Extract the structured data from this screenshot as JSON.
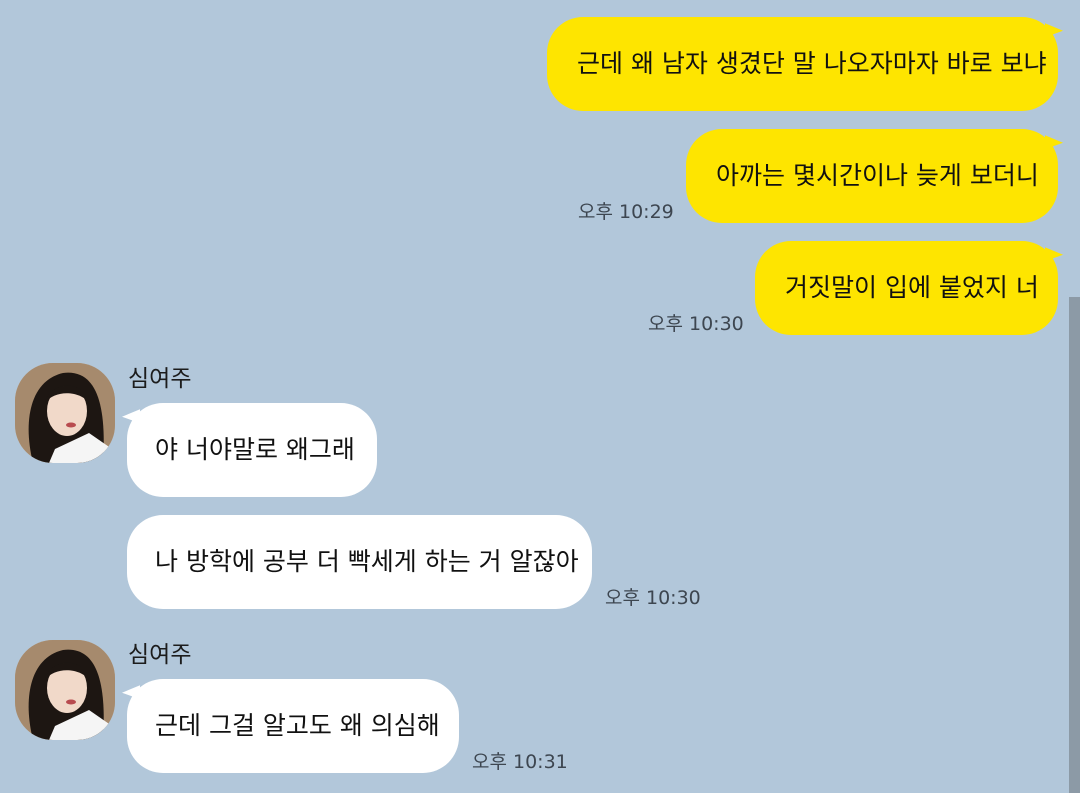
{
  "messages": {
    "m1": {
      "text": "근데 왜 남자 생겼단 말 나오자마자 바로 보냐"
    },
    "m2": {
      "text": "아까는 몇시간이나 늦게 보더니",
      "time": "오후 10:29"
    },
    "m3": {
      "text": "거짓말이 입에 붙었지 너",
      "time": "오후 10:30"
    },
    "m4": {
      "sender": "심여주",
      "text": "야 너야말로 왜그래"
    },
    "m5": {
      "text": "나 방학에 공부 더 빡세게 하는 거 알잖아",
      "time": "오후 10:30"
    },
    "m6": {
      "sender": "심여주",
      "text": "근데 그걸 알고도 왜 의심해",
      "time": "오후 10:31"
    }
  },
  "colors": {
    "background": "#b2c7da",
    "outgoing_bubble": "#fee500",
    "incoming_bubble": "#ffffff"
  }
}
